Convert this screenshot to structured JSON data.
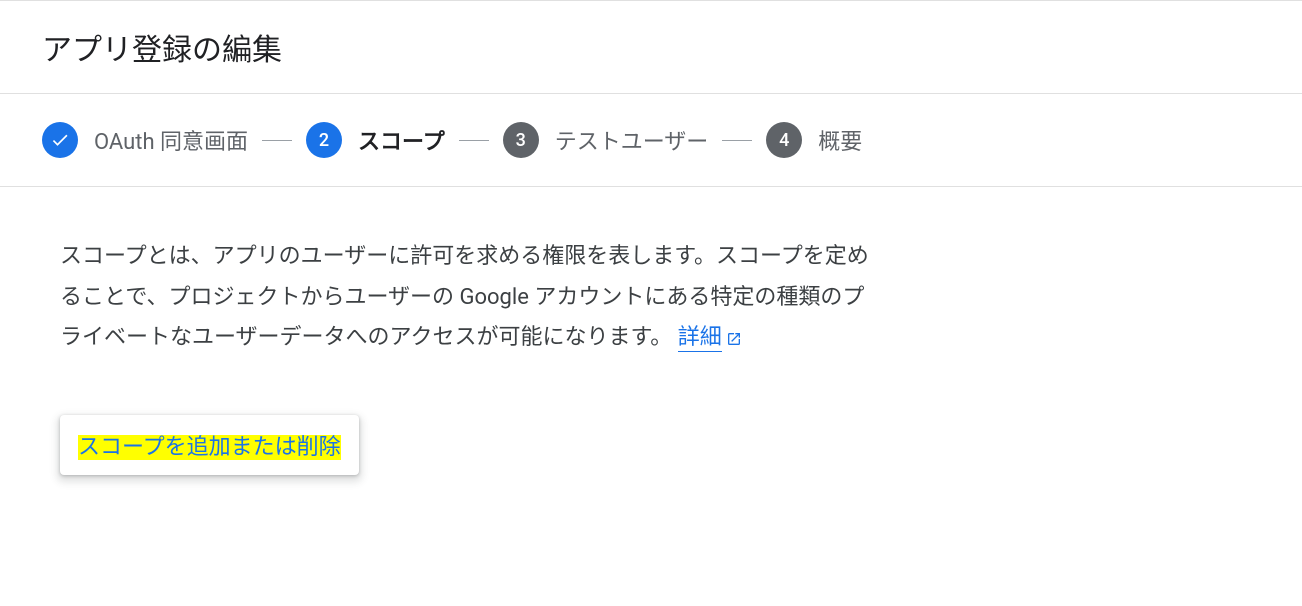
{
  "header": {
    "title": "アプリ登録の編集"
  },
  "stepper": {
    "steps": [
      {
        "number": "1",
        "label": "OAuth 同意画面",
        "state": "completed"
      },
      {
        "number": "2",
        "label": "スコープ",
        "state": "active"
      },
      {
        "number": "3",
        "label": "テストユーザー",
        "state": "inactive"
      },
      {
        "number": "4",
        "label": "概要",
        "state": "inactive"
      }
    ]
  },
  "content": {
    "description": "スコープとは、アプリのユーザーに許可を求める権限を表します。スコープを定めることで、プロジェクトからユーザーの Google アカウントにある特定の種類のプライベートなユーザーデータへのアクセスが可能になります。",
    "learn_more": "詳細",
    "add_remove_button": "スコープを追加または削除"
  }
}
